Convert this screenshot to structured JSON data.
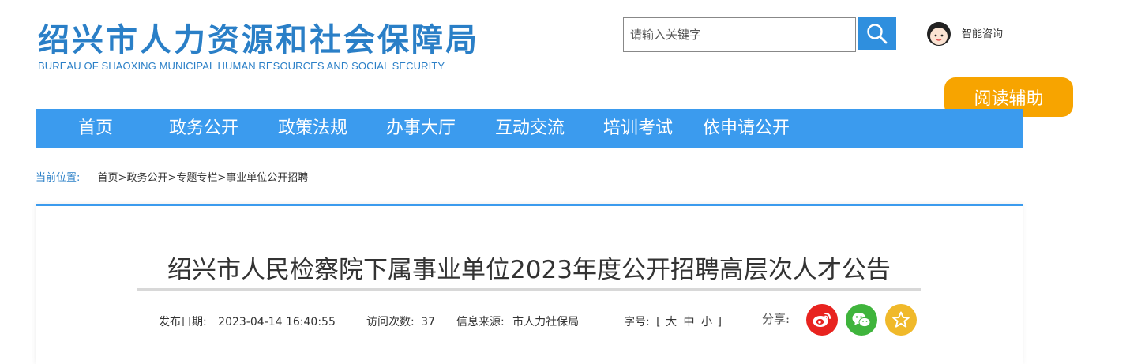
{
  "header": {
    "title_cn": "绍兴市人力资源和社会保障局",
    "title_en": "BUREAU OF SHAOXING MUNICIPAL HUMAN RESOURCES AND SOCIAL SECURITY",
    "search": {
      "placeholder": "请输入关键字",
      "value": ""
    },
    "assistant_label": "智能咨询",
    "reading_aid_label": "阅读辅助"
  },
  "nav": {
    "items": [
      {
        "label": "首页"
      },
      {
        "label": "政务公开"
      },
      {
        "label": "政策法规"
      },
      {
        "label": "办事大厅"
      },
      {
        "label": "互动交流"
      },
      {
        "label": "培训考试"
      },
      {
        "label": "依申请公开"
      }
    ]
  },
  "breadcrumb": {
    "label": "当前位置:",
    "items": [
      "首页",
      "政务公开",
      "专题专栏",
      "事业单位公开招聘"
    ],
    "separator": ">"
  },
  "article": {
    "title": "绍兴市人民检察院下属事业单位2023年度公开招聘高层次人才公告",
    "publish_label": "发布日期:",
    "publish_date": "2023-04-14 16:40:55",
    "visits_label": "访问次数:",
    "visits": "37",
    "source_label": "信息来源:",
    "source": "市人力社保局",
    "font_size_label": "字号:",
    "font_open": "[",
    "font_large": "大",
    "font_medium": "中",
    "font_small": "小",
    "font_close": "]",
    "share_label": "分享:"
  },
  "colors": {
    "brand_blue": "#2a7fc7",
    "nav_blue": "#3b9bee",
    "reading_aid_orange": "#f7a400",
    "weibo_red": "#e8231f",
    "wechat_green": "#3fb43c",
    "favorite_yellow": "#f0b92a"
  },
  "icons": [
    "search-icon",
    "assistant-avatar-icon",
    "weibo-icon",
    "wechat-icon",
    "favorite-star-icon"
  ]
}
